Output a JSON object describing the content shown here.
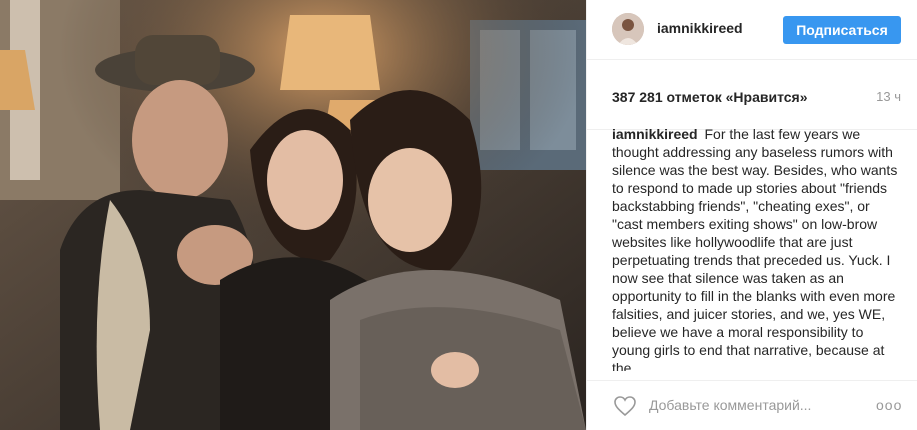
{
  "header": {
    "username": "iamnikkireed",
    "follow_label": "Подписаться"
  },
  "stats": {
    "likes": "387 281 отметок «Нравится»",
    "time": "13 ч"
  },
  "caption": {
    "author": "iamnikkireed",
    "text": "For the last few years we thought addressing any baseless rumors with silence was the best way. Besides, who wants to respond to made up stories about \"friends backstabbing friends\", \"cheating exes\", or \"cast members exiting shows\" on low-brow websites like hollywoodlife that are just perpetuating trends that preceded us. Yuck. I now see that silence was taken as an opportunity to fill in the blanks with even more falsities, and juicer stories, and we, yes WE, believe we have a moral responsibility to young girls to end that narrative, because at the"
  },
  "comment": {
    "placeholder": "Добавьте комментарий...",
    "more_label": "ooo"
  },
  "colors": {
    "accent": "#3897f0",
    "text": "#262626",
    "muted": "#999999",
    "border": "#efefef"
  },
  "icons": {
    "like": "heart-icon",
    "more": "more-options-icon"
  }
}
